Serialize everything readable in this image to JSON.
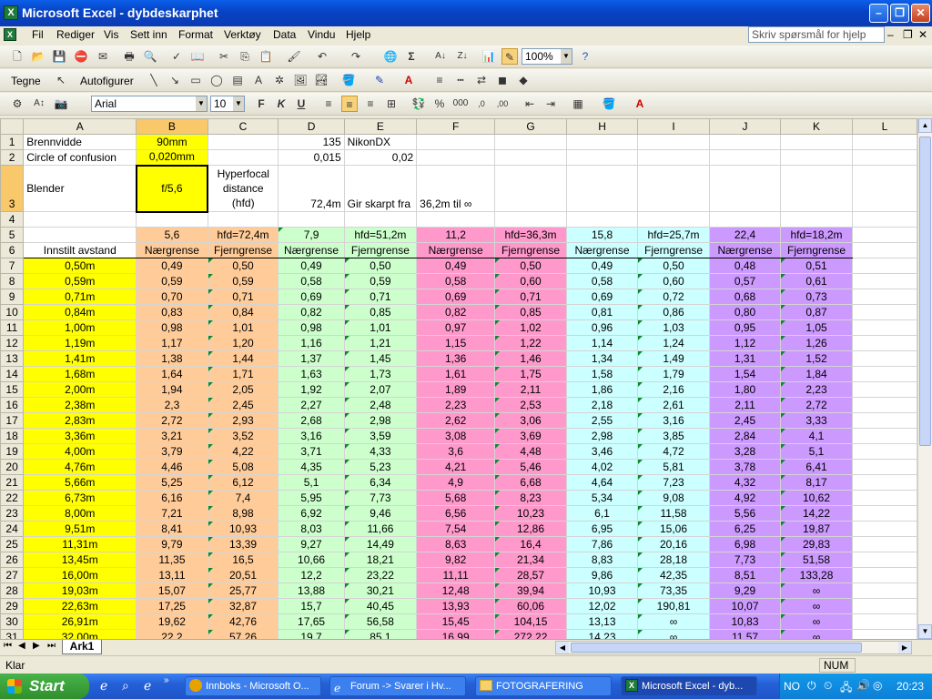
{
  "window": {
    "title": "Microsoft Excel - dybdeskarphet"
  },
  "menu": [
    "Fil",
    "Rediger",
    "Vis",
    "Sett inn",
    "Format",
    "Verktøy",
    "Data",
    "Vindu",
    "Hjelp"
  ],
  "help_placeholder": "Skriv spørsmål for hjelp",
  "toolbar": {
    "zoom": "100%",
    "draw_label": "Tegne",
    "autoshapes_label": "Autofigurer",
    "font": "Arial",
    "font_size": "10"
  },
  "sheet": {
    "columns": [
      "A",
      "B",
      "C",
      "D",
      "E",
      "F",
      "G",
      "H",
      "I",
      "J",
      "K",
      "L"
    ],
    "top_rows": {
      "r1": {
        "a": "Brennvidde",
        "b": "90mm",
        "d": "135",
        "e": "NikonDX"
      },
      "r2": {
        "a": "Circle of confusion",
        "b": "0,020mm",
        "d": "0,015",
        "e": "0,02"
      },
      "r3": {
        "a": "Blender",
        "b": "f/5,6",
        "c": "Hyperfocal distance (hfd)",
        "d": "72,4m",
        "e": "Gir skarpt fra",
        "f": "36,2m til ∞"
      }
    },
    "row5": [
      "5,6",
      "hfd=72,4m",
      "7,9",
      "hfd=51,2m",
      "11,2",
      "hfd=36,3m",
      "15,8",
      "hfd=25,7m",
      "22,4",
      "hfd=18,2m"
    ],
    "row6": {
      "a": "Innstilt avstand",
      "pairs": [
        "Nærgrense",
        "Fjerngrense",
        "Nærgrense",
        "Fjerngrense",
        "Nærgrense",
        "Fjerngrense",
        "Nærgrense",
        "Fjerngrense",
        "Nærgrense",
        "Fjerngrense"
      ]
    },
    "data_rows": [
      {
        "n": "7",
        "a": "0,50m",
        "v": [
          "0,49",
          "0,50",
          "0,49",
          "0,50",
          "0,49",
          "0,50",
          "0,49",
          "0,50",
          "0,48",
          "0,51"
        ]
      },
      {
        "n": "8",
        "a": "0,59m",
        "v": [
          "0,59",
          "0,59",
          "0,58",
          "0,59",
          "0,58",
          "0,60",
          "0,58",
          "0,60",
          "0,57",
          "0,61"
        ]
      },
      {
        "n": "9",
        "a": "0,71m",
        "v": [
          "0,70",
          "0,71",
          "0,69",
          "0,71",
          "0,69",
          "0,71",
          "0,69",
          "0,72",
          "0,68",
          "0,73"
        ]
      },
      {
        "n": "10",
        "a": "0,84m",
        "v": [
          "0,83",
          "0,84",
          "0,82",
          "0,85",
          "0,82",
          "0,85",
          "0,81",
          "0,86",
          "0,80",
          "0,87"
        ]
      },
      {
        "n": "11",
        "a": "1,00m",
        "v": [
          "0,98",
          "1,01",
          "0,98",
          "1,01",
          "0,97",
          "1,02",
          "0,96",
          "1,03",
          "0,95",
          "1,05"
        ]
      },
      {
        "n": "12",
        "a": "1,19m",
        "v": [
          "1,17",
          "1,20",
          "1,16",
          "1,21",
          "1,15",
          "1,22",
          "1,14",
          "1,24",
          "1,12",
          "1,26"
        ]
      },
      {
        "n": "13",
        "a": "1,41m",
        "v": [
          "1,38",
          "1,44",
          "1,37",
          "1,45",
          "1,36",
          "1,46",
          "1,34",
          "1,49",
          "1,31",
          "1,52"
        ]
      },
      {
        "n": "14",
        "a": "1,68m",
        "v": [
          "1,64",
          "1,71",
          "1,63",
          "1,73",
          "1,61",
          "1,75",
          "1,58",
          "1,79",
          "1,54",
          "1,84"
        ]
      },
      {
        "n": "15",
        "a": "2,00m",
        "v": [
          "1,94",
          "2,05",
          "1,92",
          "2,07",
          "1,89",
          "2,11",
          "1,86",
          "2,16",
          "1,80",
          "2,23"
        ]
      },
      {
        "n": "16",
        "a": "2,38m",
        "v": [
          "2,3",
          "2,45",
          "2,27",
          "2,48",
          "2,23",
          "2,53",
          "2,18",
          "2,61",
          "2,11",
          "2,72"
        ]
      },
      {
        "n": "17",
        "a": "2,83m",
        "v": [
          "2,72",
          "2,93",
          "2,68",
          "2,98",
          "2,62",
          "3,06",
          "2,55",
          "3,16",
          "2,45",
          "3,33"
        ]
      },
      {
        "n": "18",
        "a": "3,36m",
        "v": [
          "3,21",
          "3,52",
          "3,16",
          "3,59",
          "3,08",
          "3,69",
          "2,98",
          "3,85",
          "2,84",
          "4,1"
        ]
      },
      {
        "n": "19",
        "a": "4,00m",
        "v": [
          "3,79",
          "4,22",
          "3,71",
          "4,33",
          "3,6",
          "4,48",
          "3,46",
          "4,72",
          "3,28",
          "5,1"
        ]
      },
      {
        "n": "20",
        "a": "4,76m",
        "v": [
          "4,46",
          "5,08",
          "4,35",
          "5,23",
          "4,21",
          "5,46",
          "4,02",
          "5,81",
          "3,78",
          "6,41"
        ]
      },
      {
        "n": "21",
        "a": "5,66m",
        "v": [
          "5,25",
          "6,12",
          "5,1",
          "6,34",
          "4,9",
          "6,68",
          "4,64",
          "7,23",
          "4,32",
          "8,17"
        ]
      },
      {
        "n": "22",
        "a": "6,73m",
        "v": [
          "6,16",
          "7,4",
          "5,95",
          "7,73",
          "5,68",
          "8,23",
          "5,34",
          "9,08",
          "4,92",
          "10,62"
        ]
      },
      {
        "n": "23",
        "a": "8,00m",
        "v": [
          "7,21",
          "8,98",
          "6,92",
          "9,46",
          "6,56",
          "10,23",
          "6,1",
          "11,58",
          "5,56",
          "14,22"
        ]
      },
      {
        "n": "24",
        "a": "9,51m",
        "v": [
          "8,41",
          "10,93",
          "8,03",
          "11,66",
          "7,54",
          "12,86",
          "6,95",
          "15,06",
          "6,25",
          "19,87"
        ]
      },
      {
        "n": "25",
        "a": "11,31m",
        "v": [
          "9,79",
          "13,39",
          "9,27",
          "14,49",
          "8,63",
          "16,4",
          "7,86",
          "20,16",
          "6,98",
          "29,83"
        ]
      },
      {
        "n": "26",
        "a": "13,45m",
        "v": [
          "11,35",
          "16,5",
          "10,66",
          "18,21",
          "9,82",
          "21,34",
          "8,83",
          "28,18",
          "7,73",
          "51,58"
        ]
      },
      {
        "n": "27",
        "a": "16,00m",
        "v": [
          "13,11",
          "20,51",
          "12,2",
          "23,22",
          "11,11",
          "28,57",
          "9,86",
          "42,35",
          "8,51",
          "133,28"
        ]
      },
      {
        "n": "28",
        "a": "19,03m",
        "v": [
          "15,07",
          "25,77",
          "13,88",
          "30,21",
          "12,48",
          "39,94",
          "10,93",
          "73,35",
          "9,29",
          "∞"
        ]
      },
      {
        "n": "29",
        "a": "22,63m",
        "v": [
          "17,25",
          "32,87",
          "15,7",
          "40,45",
          "13,93",
          "60,06",
          "12,02",
          "190,81",
          "10,07",
          "∞"
        ]
      },
      {
        "n": "30",
        "a": "26,91m",
        "v": [
          "19,62",
          "42,76",
          "17,65",
          "56,58",
          "15,45",
          "104,15",
          "13,13",
          "∞",
          "10,83",
          "∞"
        ]
      },
      {
        "n": "31",
        "a": "32,00m",
        "v": [
          "22,2",
          "57,26",
          "19,7",
          "85,1",
          "16,99",
          "272,22",
          "14,23",
          "∞",
          "11,57",
          "∞"
        ]
      }
    ]
  },
  "sheet_tab": "Ark1",
  "status": {
    "left": "Klar",
    "num": "NUM"
  },
  "taskbar": {
    "start": "Start",
    "tasks": [
      "Innboks - Microsoft O...",
      "Forum -> Svarer i Hv...",
      "FOTOGRAFERING",
      "Microsoft Excel - dyb..."
    ],
    "lang": "NO",
    "clock": "20:23"
  },
  "colors": {
    "selected_header": "#f8c86a",
    "yellow": "#ffff00",
    "orange": "#ffcc99",
    "green": "#ccffcc",
    "pink": "#ff99cc",
    "cyan": "#ccffff",
    "purple": "#cc99ff"
  }
}
